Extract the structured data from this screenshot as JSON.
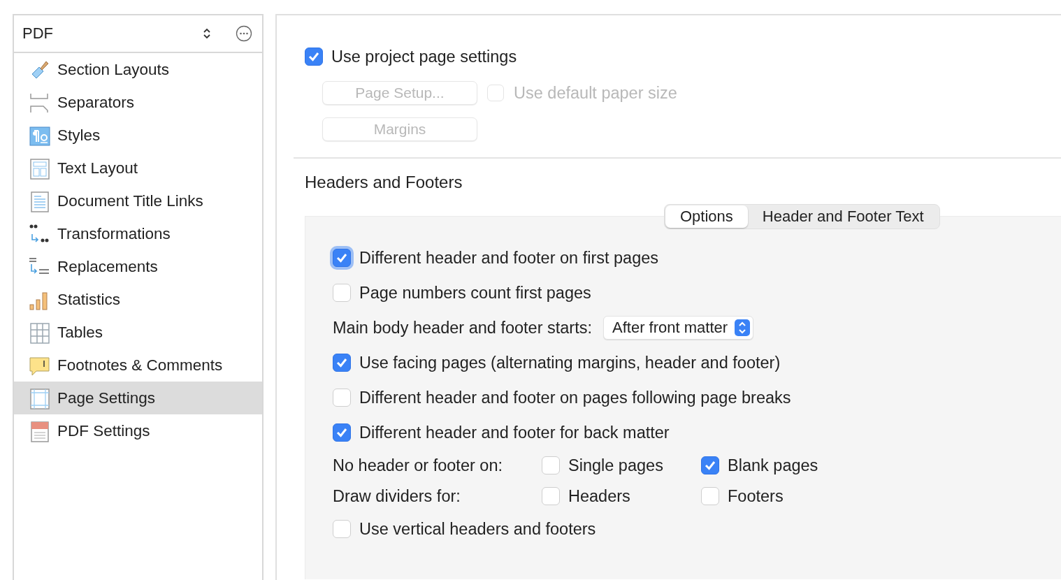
{
  "sidebar": {
    "title": "PDF",
    "items": [
      {
        "label": "Section Layouts",
        "selected": false
      },
      {
        "label": "Separators",
        "selected": false
      },
      {
        "label": "Styles",
        "selected": false
      },
      {
        "label": "Text Layout",
        "selected": false
      },
      {
        "label": "Document Title Links",
        "selected": false
      },
      {
        "label": "Transformations",
        "selected": false
      },
      {
        "label": "Replacements",
        "selected": false
      },
      {
        "label": "Statistics",
        "selected": false
      },
      {
        "label": "Tables",
        "selected": false
      },
      {
        "label": "Footnotes & Comments",
        "selected": false
      },
      {
        "label": "Page Settings",
        "selected": true
      },
      {
        "label": "PDF Settings",
        "selected": false
      }
    ]
  },
  "project": {
    "use_project": {
      "label": "Use project page settings",
      "checked": true
    },
    "page_setup_button": {
      "label": "Page Setup...",
      "disabled": true
    },
    "default_paper": {
      "label": "Use default paper size",
      "checked": false,
      "disabled": true
    },
    "margins_button": {
      "label": "Margins",
      "disabled": true
    }
  },
  "headers_footers": {
    "title": "Headers and Footers",
    "tabs": [
      {
        "label": "Options",
        "selected": true
      },
      {
        "label": "Header and Footer Text",
        "selected": false
      }
    ],
    "options": [
      {
        "kind": "checkbox",
        "label": "Different header and footer on first pages",
        "checked": true,
        "focused": true
      },
      {
        "kind": "checkbox",
        "label": "Page numbers count first pages",
        "checked": false,
        "focused": false
      },
      {
        "kind": "select",
        "label": "Main body header and footer starts:",
        "value": "After front matter"
      },
      {
        "kind": "checkbox",
        "label": "Use facing pages (alternating margins, header and footer)",
        "checked": true,
        "focused": false
      },
      {
        "kind": "checkbox",
        "label": "Different header and footer on pages following page breaks",
        "checked": false,
        "focused": false
      },
      {
        "kind": "checkbox",
        "label": "Different header and footer for back matter",
        "checked": true,
        "focused": false
      },
      {
        "kind": "pair",
        "label": "No header or footer on:",
        "choices": [
          {
            "label": "Single pages",
            "checked": false
          },
          {
            "label": "Blank pages",
            "checked": true
          }
        ]
      },
      {
        "kind": "pair",
        "label": "Draw dividers for:",
        "choices": [
          {
            "label": "Headers",
            "checked": false
          },
          {
            "label": "Footers",
            "checked": false
          }
        ]
      },
      {
        "kind": "checkbox",
        "label": "Use vertical headers and footers",
        "checked": false,
        "focused": false
      }
    ]
  }
}
